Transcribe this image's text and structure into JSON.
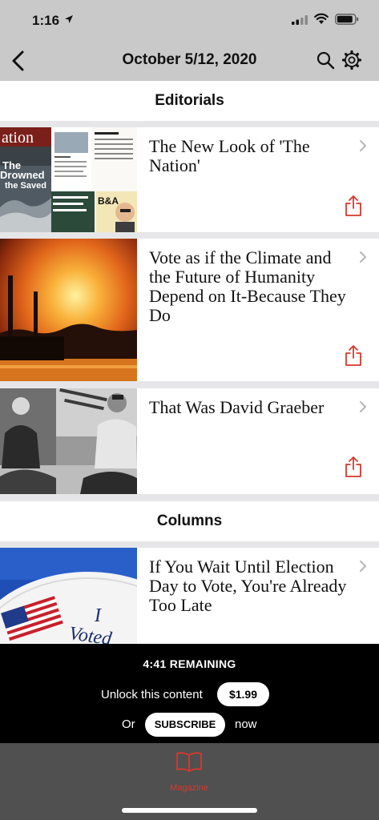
{
  "status_bar": {
    "time": "1:16"
  },
  "nav": {
    "title": "October 5/12, 2020"
  },
  "sections": [
    {
      "title": "Editorials"
    },
    {
      "title": "Columns"
    }
  ],
  "articles": [
    {
      "title": "The New Look of 'The Nation'"
    },
    {
      "title": "Vote as if the Climate and the Future of Humanity Depend on It-Because They Do"
    },
    {
      "title": "That Was David Graeber"
    },
    {
      "title": "If You Wait Until Election Day to Vote, You're Already Too Late"
    }
  ],
  "thumbnails": {
    "nation_cover": {
      "masthead": "ation",
      "headline_1": "The",
      "headline_2": "Drowned",
      "headline_3": "the Saved",
      "badge": "B&A"
    },
    "voted_sticker": {
      "text_1": "I",
      "text_2": "Voted"
    }
  },
  "paywall": {
    "remaining": "4:41 REMAINING",
    "unlock_text": "Unlock this content",
    "price": "$1.99",
    "or_text": "Or",
    "subscribe_label": "SUBSCRIBE",
    "now_text": "now"
  },
  "tabbar": {
    "magazine_label": "Magazine"
  },
  "colors": {
    "accent": "#d6382d",
    "nav_bg": "#c9c9c9",
    "separator": "#e6e6e8"
  }
}
